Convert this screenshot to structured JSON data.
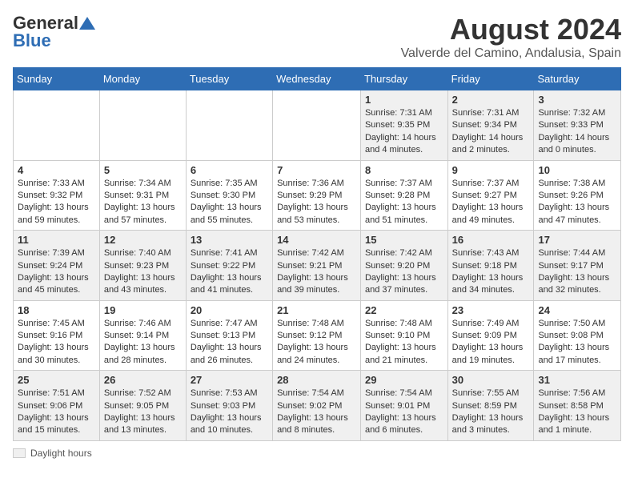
{
  "header": {
    "logo_general": "General",
    "logo_blue": "Blue",
    "month_title": "August 2024",
    "location": "Valverde del Camino, Andalusia, Spain"
  },
  "calendar": {
    "days_of_week": [
      "Sunday",
      "Monday",
      "Tuesday",
      "Wednesday",
      "Thursday",
      "Friday",
      "Saturday"
    ],
    "weeks": [
      [
        {
          "day": "",
          "info": ""
        },
        {
          "day": "",
          "info": ""
        },
        {
          "day": "",
          "info": ""
        },
        {
          "day": "",
          "info": ""
        },
        {
          "day": "1",
          "info": "Sunrise: 7:31 AM\nSunset: 9:35 PM\nDaylight: 14 hours and 4 minutes."
        },
        {
          "day": "2",
          "info": "Sunrise: 7:31 AM\nSunset: 9:34 PM\nDaylight: 14 hours and 2 minutes."
        },
        {
          "day": "3",
          "info": "Sunrise: 7:32 AM\nSunset: 9:33 PM\nDaylight: 14 hours and 0 minutes."
        }
      ],
      [
        {
          "day": "4",
          "info": "Sunrise: 7:33 AM\nSunset: 9:32 PM\nDaylight: 13 hours and 59 minutes."
        },
        {
          "day": "5",
          "info": "Sunrise: 7:34 AM\nSunset: 9:31 PM\nDaylight: 13 hours and 57 minutes."
        },
        {
          "day": "6",
          "info": "Sunrise: 7:35 AM\nSunset: 9:30 PM\nDaylight: 13 hours and 55 minutes."
        },
        {
          "day": "7",
          "info": "Sunrise: 7:36 AM\nSunset: 9:29 PM\nDaylight: 13 hours and 53 minutes."
        },
        {
          "day": "8",
          "info": "Sunrise: 7:37 AM\nSunset: 9:28 PM\nDaylight: 13 hours and 51 minutes."
        },
        {
          "day": "9",
          "info": "Sunrise: 7:37 AM\nSunset: 9:27 PM\nDaylight: 13 hours and 49 minutes."
        },
        {
          "day": "10",
          "info": "Sunrise: 7:38 AM\nSunset: 9:26 PM\nDaylight: 13 hours and 47 minutes."
        }
      ],
      [
        {
          "day": "11",
          "info": "Sunrise: 7:39 AM\nSunset: 9:24 PM\nDaylight: 13 hours and 45 minutes."
        },
        {
          "day": "12",
          "info": "Sunrise: 7:40 AM\nSunset: 9:23 PM\nDaylight: 13 hours and 43 minutes."
        },
        {
          "day": "13",
          "info": "Sunrise: 7:41 AM\nSunset: 9:22 PM\nDaylight: 13 hours and 41 minutes."
        },
        {
          "day": "14",
          "info": "Sunrise: 7:42 AM\nSunset: 9:21 PM\nDaylight: 13 hours and 39 minutes."
        },
        {
          "day": "15",
          "info": "Sunrise: 7:42 AM\nSunset: 9:20 PM\nDaylight: 13 hours and 37 minutes."
        },
        {
          "day": "16",
          "info": "Sunrise: 7:43 AM\nSunset: 9:18 PM\nDaylight: 13 hours and 34 minutes."
        },
        {
          "day": "17",
          "info": "Sunrise: 7:44 AM\nSunset: 9:17 PM\nDaylight: 13 hours and 32 minutes."
        }
      ],
      [
        {
          "day": "18",
          "info": "Sunrise: 7:45 AM\nSunset: 9:16 PM\nDaylight: 13 hours and 30 minutes."
        },
        {
          "day": "19",
          "info": "Sunrise: 7:46 AM\nSunset: 9:14 PM\nDaylight: 13 hours and 28 minutes."
        },
        {
          "day": "20",
          "info": "Sunrise: 7:47 AM\nSunset: 9:13 PM\nDaylight: 13 hours and 26 minutes."
        },
        {
          "day": "21",
          "info": "Sunrise: 7:48 AM\nSunset: 9:12 PM\nDaylight: 13 hours and 24 minutes."
        },
        {
          "day": "22",
          "info": "Sunrise: 7:48 AM\nSunset: 9:10 PM\nDaylight: 13 hours and 21 minutes."
        },
        {
          "day": "23",
          "info": "Sunrise: 7:49 AM\nSunset: 9:09 PM\nDaylight: 13 hours and 19 minutes."
        },
        {
          "day": "24",
          "info": "Sunrise: 7:50 AM\nSunset: 9:08 PM\nDaylight: 13 hours and 17 minutes."
        }
      ],
      [
        {
          "day": "25",
          "info": "Sunrise: 7:51 AM\nSunset: 9:06 PM\nDaylight: 13 hours and 15 minutes."
        },
        {
          "day": "26",
          "info": "Sunrise: 7:52 AM\nSunset: 9:05 PM\nDaylight: 13 hours and 13 minutes."
        },
        {
          "day": "27",
          "info": "Sunrise: 7:53 AM\nSunset: 9:03 PM\nDaylight: 13 hours and 10 minutes."
        },
        {
          "day": "28",
          "info": "Sunrise: 7:54 AM\nSunset: 9:02 PM\nDaylight: 13 hours and 8 minutes."
        },
        {
          "day": "29",
          "info": "Sunrise: 7:54 AM\nSunset: 9:01 PM\nDaylight: 13 hours and 6 minutes."
        },
        {
          "day": "30",
          "info": "Sunrise: 7:55 AM\nSunset: 8:59 PM\nDaylight: 13 hours and 3 minutes."
        },
        {
          "day": "31",
          "info": "Sunrise: 7:56 AM\nSunset: 8:58 PM\nDaylight: 13 hours and 1 minute."
        }
      ]
    ]
  },
  "footer": {
    "daylight_label": "Daylight hours"
  }
}
